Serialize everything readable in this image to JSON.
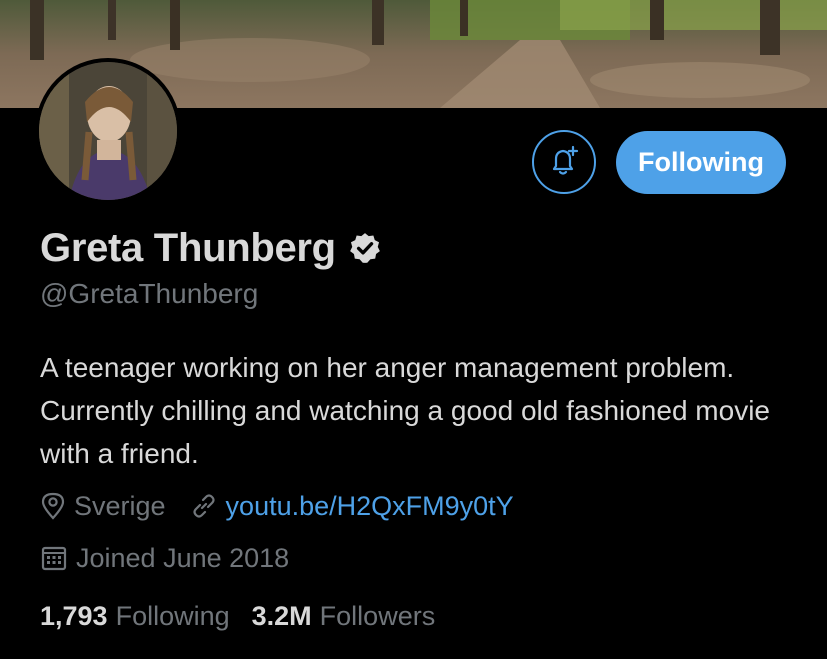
{
  "profile": {
    "name": "Greta Thunberg",
    "handle": "@GretaThunberg",
    "bio": "A teenager working on her anger management problem. Currently chilling and watching a good old fashioned movie with a friend.",
    "location": "Sverige",
    "link": "youtu.be/H2QxFM9y0tY",
    "joined": "Joined June 2018",
    "following_count": "1,793",
    "following_label": "Following",
    "followers_count": "3.2M",
    "followers_label": "Followers",
    "verified": true
  },
  "actions": {
    "follow_button_label": "Following",
    "notify_icon": "bell-plus-icon"
  },
  "icons": {
    "location": "location-pin-icon",
    "link": "link-icon",
    "joined": "calendar-icon",
    "verified": "verified-badge-icon"
  },
  "colors": {
    "background": "#000000",
    "accent": "#4ea1e8",
    "primary_text": "#d9d9d9",
    "secondary_text": "#71767b"
  }
}
